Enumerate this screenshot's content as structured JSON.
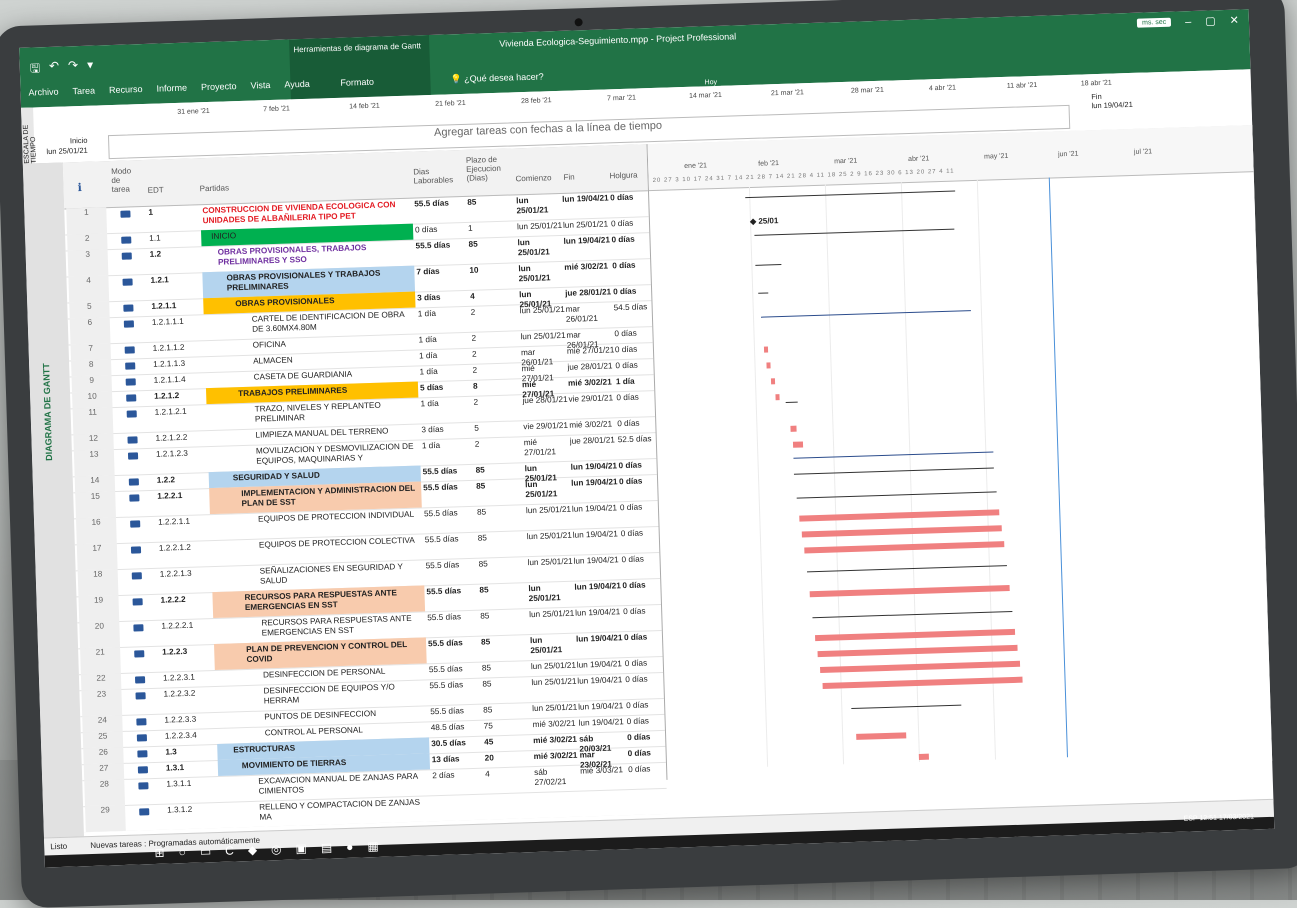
{
  "app": {
    "doc_title": "Vivienda Ecologica-Seguimiento.mpp - Project Professional",
    "tools_title": "Herramientas de diagrama de Gantt",
    "format_tab": "Formato",
    "tell_me": "¿Qué desea hacer?",
    "user_badge": "ms. sec",
    "tabs": [
      "Archivo",
      "Tarea",
      "Recurso",
      "Informe",
      "Proyecto",
      "Vista",
      "Ayuda"
    ],
    "today_label": "Hoy"
  },
  "timeline": {
    "side_label": "ESCALA DE TIEMPO",
    "dates": [
      "31 ene '21",
      "7 feb '21",
      "14 feb '21",
      "21 feb '21",
      "28 feb '21",
      "7 mar '21",
      "14 mar '21",
      "21 mar '21",
      "28 mar '21",
      "4 abr '21",
      "11 abr '21",
      "18 abr '21"
    ],
    "start_label": "Inicio",
    "start_date": "lun 25/01/21",
    "end_label": "Fin",
    "end_date": "lun 19/04/21",
    "prompt": "Agregar tareas con fechas a la línea de tiempo"
  },
  "side_view_label": "DIAGRAMA DE GANTT",
  "columns": {
    "info": "ℹ",
    "mode": "Modo de tarea",
    "edt": "EDT",
    "name": "Partidas",
    "duration": "Dias Laborables",
    "plazo": "Plazo de Ejecucion (Dias)",
    "start": "Comienzo",
    "finish": "Fin",
    "slack": "Holgura"
  },
  "rows": [
    {
      "id": "1",
      "edt": "1",
      "name": "CONSTRUCCION DE VIVIENDA ECOLOGICA CON UNIDADES DE ALBAÑILERIA TIPO PET",
      "dur": "55.5 días",
      "plazo": "85",
      "start": "lun 25/01/21",
      "fin": "lun 19/04/21",
      "hol": "0 días"
    },
    {
      "id": "2",
      "edt": "1.1",
      "name": "INICIO",
      "dur": "0 días",
      "plazo": "1",
      "start": "lun 25/01/21",
      "fin": "lun 25/01/21",
      "hol": "0 días"
    },
    {
      "id": "3",
      "edt": "1.2",
      "name": "OBRAS PROVISIONALES, TRABAJOS PRELIMINARES Y SSO",
      "dur": "55.5 días",
      "plazo": "85",
      "start": "lun 25/01/21",
      "fin": "lun 19/04/21",
      "hol": "0 días"
    },
    {
      "id": "4",
      "edt": "1.2.1",
      "name": "OBRAS PROVISIONALES Y TRABAJOS PRELIMINARES",
      "dur": "7 días",
      "plazo": "10",
      "start": "lun 25/01/21",
      "fin": "mié 3/02/21",
      "hol": "0 días"
    },
    {
      "id": "5",
      "edt": "1.2.1.1",
      "name": "OBRAS PROVISIONALES",
      "dur": "3 días",
      "plazo": "4",
      "start": "lun 25/01/21",
      "fin": "jue 28/01/21",
      "hol": "0 días"
    },
    {
      "id": "6",
      "edt": "1.2.1.1.1",
      "name": "CARTEL DE IDENTIFICACION DE OBRA DE 3.60MX4.80M",
      "dur": "1 día",
      "plazo": "2",
      "start": "lun 25/01/21",
      "fin": "mar 26/01/21",
      "hol": "54.5 días"
    },
    {
      "id": "7",
      "edt": "1.2.1.1.2",
      "name": "OFICINA",
      "dur": "1 día",
      "plazo": "2",
      "start": "lun 25/01/21",
      "fin": "mar 26/01/21",
      "hol": "0 días"
    },
    {
      "id": "8",
      "edt": "1.2.1.1.3",
      "name": "ALMACEN",
      "dur": "1 día",
      "plazo": "2",
      "start": "mar 26/01/21",
      "fin": "mié 27/01/21",
      "hol": "0 días"
    },
    {
      "id": "9",
      "edt": "1.2.1.1.4",
      "name": "CASETA DE GUARDIANIA",
      "dur": "1 día",
      "plazo": "2",
      "start": "mié 27/01/21",
      "fin": "jue 28/01/21",
      "hol": "0 días"
    },
    {
      "id": "10",
      "edt": "1.2.1.2",
      "name": "TRABAJOS PRELIMINARES",
      "dur": "5 días",
      "plazo": "8",
      "start": "mié 27/01/21",
      "fin": "mié 3/02/21",
      "hol": "1 día"
    },
    {
      "id": "11",
      "edt": "1.2.1.2.1",
      "name": "TRAZO, NIVELES Y REPLANTEO PRELIMINAR",
      "dur": "1 día",
      "plazo": "2",
      "start": "jue 28/01/21",
      "fin": "vie 29/01/21",
      "hol": "0 días"
    },
    {
      "id": "12",
      "edt": "1.2.1.2.2",
      "name": "LIMPIEZA MANUAL DEL TERRENO",
      "dur": "3 días",
      "plazo": "5",
      "start": "vie 29/01/21",
      "fin": "mié 3/02/21",
      "hol": "0 días"
    },
    {
      "id": "13",
      "edt": "1.2.1.2.3",
      "name": "MOVILIZACION Y DESMOVILIZACION DE EQUIPOS, MAQUINARIAS Y",
      "dur": "1 día",
      "plazo": "2",
      "start": "mié 27/01/21",
      "fin": "jue 28/01/21",
      "hol": "52.5 días"
    },
    {
      "id": "14",
      "edt": "1.2.2",
      "name": "SEGURIDAD Y SALUD",
      "dur": "55.5 días",
      "plazo": "85",
      "start": "lun 25/01/21",
      "fin": "lun 19/04/21",
      "hol": "0 días"
    },
    {
      "id": "15",
      "edt": "1.2.2.1",
      "name": "IMPLEMENTACION Y ADMINISTRACION DEL PLAN DE SST",
      "dur": "55.5 días",
      "plazo": "85",
      "start": "lun 25/01/21",
      "fin": "lun 19/04/21",
      "hol": "0 días"
    },
    {
      "id": "16",
      "edt": "1.2.2.1.1",
      "name": "EQUIPOS DE PROTECCION INDIVIDUAL",
      "dur": "55.5 días",
      "plazo": "85",
      "start": "lun 25/01/21",
      "fin": "lun 19/04/21",
      "hol": "0 días"
    },
    {
      "id": "17",
      "edt": "1.2.2.1.2",
      "name": "EQUIPOS DE PROTECCION COLECTIVA",
      "dur": "55.5 días",
      "plazo": "85",
      "start": "lun 25/01/21",
      "fin": "lun 19/04/21",
      "hol": "0 días"
    },
    {
      "id": "18",
      "edt": "1.2.2.1.3",
      "name": "SEÑALIZACIONES EN SEGURIDAD Y SALUD",
      "dur": "55.5 días",
      "plazo": "85",
      "start": "lun 25/01/21",
      "fin": "lun 19/04/21",
      "hol": "0 días"
    },
    {
      "id": "19",
      "edt": "1.2.2.2",
      "name": "RECURSOS PARA RESPUESTAS ANTE EMERGENCIAS EN SST",
      "dur": "55.5 días",
      "plazo": "85",
      "start": "lun 25/01/21",
      "fin": "lun 19/04/21",
      "hol": "0 días"
    },
    {
      "id": "20",
      "edt": "1.2.2.2.1",
      "name": "RECURSOS PARA RESPUESTAS ANTE EMERGENCIAS EN SST",
      "dur": "55.5 días",
      "plazo": "85",
      "start": "lun 25/01/21",
      "fin": "lun 19/04/21",
      "hol": "0 días"
    },
    {
      "id": "21",
      "edt": "1.2.2.3",
      "name": "PLAN DE PREVENCION Y CONTROL DEL COVID",
      "dur": "55.5 días",
      "plazo": "85",
      "start": "lun 25/01/21",
      "fin": "lun 19/04/21",
      "hol": "0 días"
    },
    {
      "id": "22",
      "edt": "1.2.2.3.1",
      "name": "DESINFECCION DE PERSONAL",
      "dur": "55.5 días",
      "plazo": "85",
      "start": "lun 25/01/21",
      "fin": "lun 19/04/21",
      "hol": "0 días"
    },
    {
      "id": "23",
      "edt": "1.2.2.3.2",
      "name": "DESINFECCION DE EQUIPOS Y/O HERRAM",
      "dur": "55.5 días",
      "plazo": "85",
      "start": "lun 25/01/21",
      "fin": "lun 19/04/21",
      "hol": "0 días"
    },
    {
      "id": "24",
      "edt": "1.2.2.3.3",
      "name": "PUNTOS DE DESINFECCION",
      "dur": "55.5 días",
      "plazo": "85",
      "start": "lun 25/01/21",
      "fin": "lun 19/04/21",
      "hol": "0 días"
    },
    {
      "id": "25",
      "edt": "1.2.2.3.4",
      "name": "CONTROL AL PERSONAL",
      "dur": "48.5 días",
      "plazo": "75",
      "start": "mié 3/02/21",
      "fin": "lun 19/04/21",
      "hol": "0 días"
    },
    {
      "id": "26",
      "edt": "1.3",
      "name": "ESTRUCTURAS",
      "dur": "30.5 días",
      "plazo": "45",
      "start": "mié 3/02/21",
      "fin": "sáb 20/03/21",
      "hol": "0 días"
    },
    {
      "id": "27",
      "edt": "1.3.1",
      "name": "MOVIMIENTO DE TIERRAS",
      "dur": "13 días",
      "plazo": "20",
      "start": "mié 3/02/21",
      "fin": "mar 23/02/21",
      "hol": "0 días"
    },
    {
      "id": "28",
      "edt": "1.3.1.1",
      "name": "EXCAVACION MANUAL DE ZANJAS PARA CIMIENTOS",
      "dur": "2 días",
      "plazo": "4",
      "start": "sáb 27/02/21",
      "fin": "mié 3/03/21",
      "hol": "0 días"
    },
    {
      "id": "29",
      "edt": "1.3.1.2",
      "name": "RELLENO Y COMPACTACION DE ZANJAS MA",
      "dur": "",
      "plazo": "",
      "start": "",
      "fin": "",
      "hol": ""
    }
  ],
  "gantt": {
    "months": [
      "ene '21",
      "feb '21",
      "mar '21",
      "abr '21",
      "may '21",
      "jun '21",
      "jul '21"
    ],
    "days": "20 27 3 10 17 24 31 7 14 21 28 7 14 21 28 4 11 18 25 2 9 16 23 30 6 13 20 27 4 11",
    "milestone": "25/01"
  },
  "status": {
    "ready": "Listo",
    "new_tasks": "Nuevas tareas : Programadas automáticamente"
  },
  "tray": {
    "lang": "ESP",
    "time": "12:51",
    "date": "17/03/2021"
  }
}
